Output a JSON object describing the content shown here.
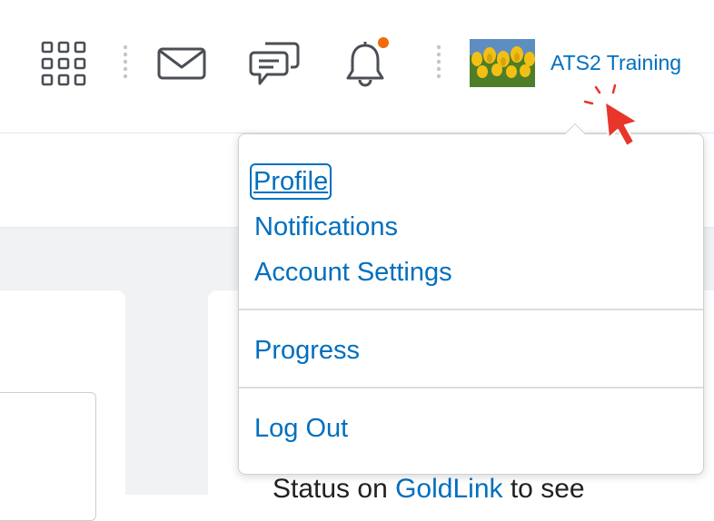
{
  "header": {
    "user_name": "ATS2 Training",
    "icons": [
      "grid-icon",
      "mail-icon",
      "chat-icon",
      "bell-icon"
    ],
    "notification_dot_color": "#f06b0a",
    "link_color": "#006fbf"
  },
  "dropdown": {
    "items": [
      {
        "label": "Profile",
        "focused": true
      },
      {
        "label": "Notifications"
      },
      {
        "label": "Account Settings"
      },
      {
        "label": "Progress"
      },
      {
        "label": "Log Out"
      }
    ]
  },
  "background": {
    "status_prefix": "Status on ",
    "status_link": "GoldLink",
    "status_suffix": " to see"
  },
  "cursor": {
    "icon": "pointer-cursor-icon",
    "color": "#e8362b"
  }
}
